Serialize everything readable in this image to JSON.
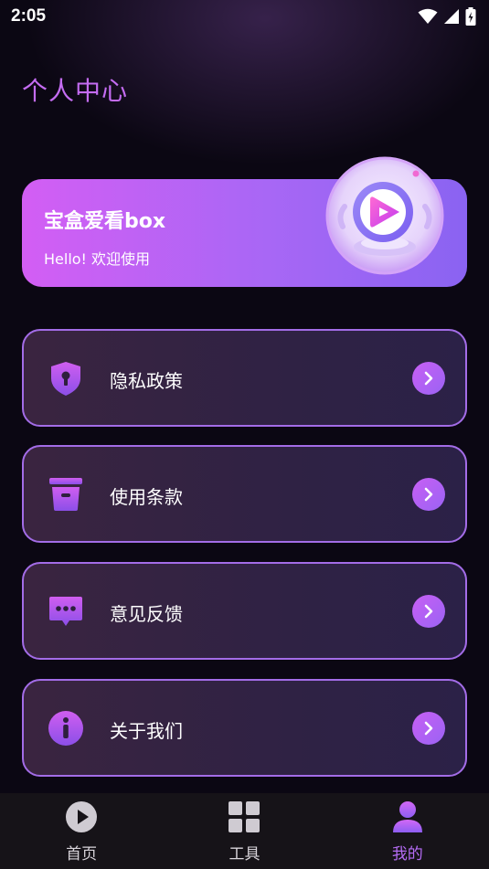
{
  "status_bar": {
    "time": "2:05"
  },
  "page": {
    "title": "个人中心"
  },
  "profile": {
    "name": "宝盒爱看box",
    "greeting": "Hello! 欢迎使用"
  },
  "menu": [
    {
      "label": "隐私政策",
      "icon": "shield-icon"
    },
    {
      "label": "使用条款",
      "icon": "document-box-icon"
    },
    {
      "label": "意见反馈",
      "icon": "chat-bubble-icon"
    },
    {
      "label": "关于我们",
      "icon": "info-icon"
    }
  ],
  "tabs": [
    {
      "label": "首页",
      "icon": "play-circle-icon",
      "active": false
    },
    {
      "label": "工具",
      "icon": "grid-icon",
      "active": false
    },
    {
      "label": "我的",
      "icon": "person-icon",
      "active": true
    }
  ],
  "colors": {
    "accent": "#c46cf2",
    "background": "#0b0713",
    "tab_active": "#b56cf5"
  }
}
